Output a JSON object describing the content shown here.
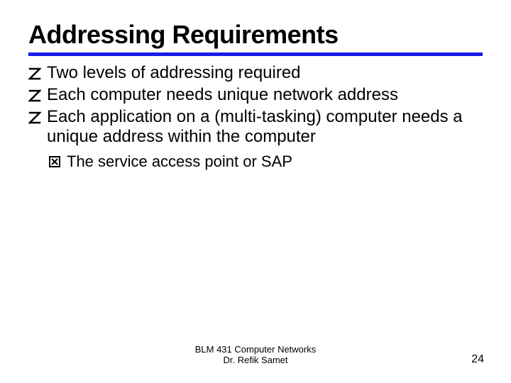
{
  "title": "Addressing Requirements",
  "bullets": [
    "Two levels of addressing required",
    "Each computer needs unique network address",
    "Each application on a (multi-tasking) computer needs a unique address within the computer"
  ],
  "sub": "The service access point or SAP",
  "footer": {
    "line1": "BLM 431 Computer Networks",
    "line2": "Dr. Refik Samet"
  },
  "page": "24"
}
